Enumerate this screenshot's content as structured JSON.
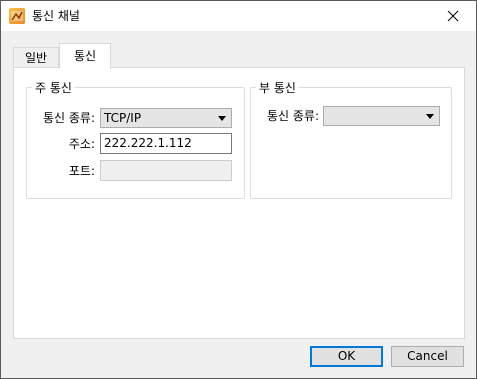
{
  "window": {
    "title": "통신 채널"
  },
  "tabs": [
    {
      "label": "일반",
      "active": false
    },
    {
      "label": "통신",
      "active": true
    }
  ],
  "primary": {
    "group_label": "주 통신",
    "type_label": "통신 종류:",
    "type_value": "TCP/IP",
    "address_label": "주소:",
    "address_value": "222.222.1.112",
    "port_label": "포트:",
    "port_value": ""
  },
  "secondary": {
    "group_label": "부 통신",
    "type_label": "통신 종류:",
    "type_value": ""
  },
  "buttons": {
    "ok": "OK",
    "cancel": "Cancel"
  },
  "colors": {
    "default_button_border": "#0078d7",
    "window_bg": "#f0f0f0"
  }
}
